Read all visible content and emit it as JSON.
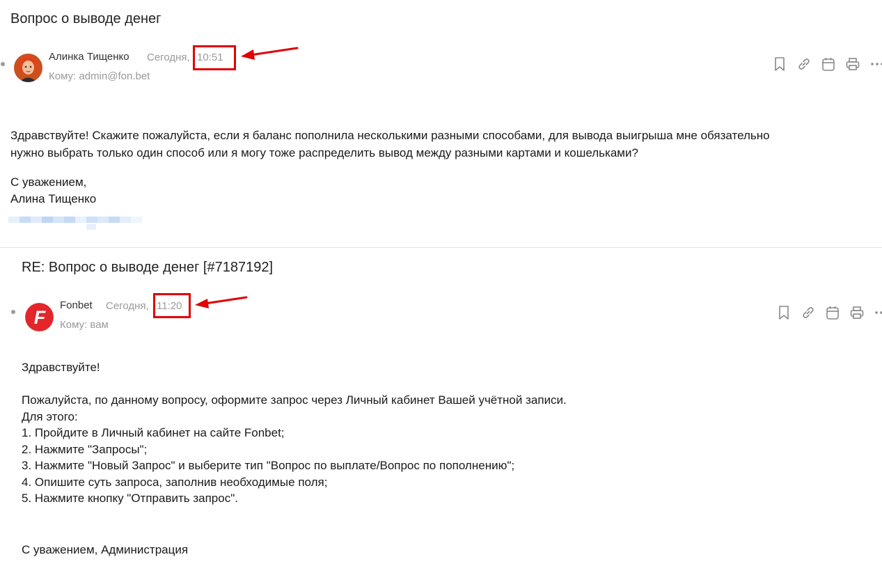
{
  "message1": {
    "subject": "Вопрос о выводе денег",
    "sender": "Алинка Тищенко",
    "date_label": "Сегодня,",
    "time": "10:51",
    "to_label": "Кому: admin@fon.bet",
    "body": [
      "Здравствуйте! Скажите пожалуйста, если я баланс пополнила несколькими разными способами, для вывода выигрыша мне обязательно",
      "нужно выбрать только один способ или я могу тоже распределить вывод между разными картами и кошельками?",
      "",
      "С уважением,",
      "Алина Тищенко"
    ]
  },
  "message2": {
    "subject": "RE: Вопрос о выводе денег [#7187192]",
    "sender": "Fonbet",
    "date_label": "Сегодня,",
    "time": "11:20",
    "to_label": "Кому: вам",
    "avatar_letter": "F",
    "body": [
      "Здравствуйте!",
      "",
      "Пожалуйста, по данному вопросу, оформите запрос через Личный кабинет Вашей учётной записи.",
      "Для этого:",
      "1. Пройдите в Личный кабинет на сайте Fonbet;",
      "2. Нажмите \"Запросы\";",
      "3. Нажмите \"Новый Запрос\" и выберите тип \"Вопрос по выплате/Вопрос по пополнению\";",
      "4. Опишите суть запроса, заполнив необходимые поля;",
      "5. Нажмите кнопку \"Отправить запрос\".",
      "",
      "",
      "С уважением, Администрация"
    ]
  },
  "toolbar_icons": [
    "bookmark-icon",
    "link-icon",
    "calendar-icon",
    "print-icon",
    "more-icon"
  ],
  "colors": {
    "highlight": "#e00000",
    "fonbet_red": "#e3262b",
    "meta_gray": "#9a9a9a"
  }
}
